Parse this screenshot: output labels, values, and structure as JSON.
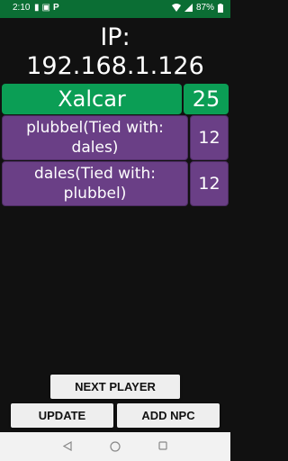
{
  "status_bar": {
    "time": "2:10",
    "left_icons": [
      "notification-icon",
      "lock-icon",
      "p-icon"
    ],
    "battery": "87%",
    "colors": {
      "bar": "#0b6e34"
    }
  },
  "ip": {
    "label": "IP:",
    "address": "192.168.1.126"
  },
  "players": [
    {
      "name": "Xalcar",
      "score": "25",
      "color": "#0b9e55"
    },
    {
      "name": "plubbel(Tied with: dales)",
      "score": "12",
      "color": "#6a3f86"
    },
    {
      "name": "dales(Tied with: plubbel)",
      "score": "12",
      "color": "#6a3f86"
    }
  ],
  "buttons": {
    "next_player": "NEXT PLAYER",
    "update": "UPDATE",
    "add_npc": "ADD NPC"
  },
  "nav_icons": [
    "back-icon",
    "home-icon",
    "recents-icon"
  ]
}
